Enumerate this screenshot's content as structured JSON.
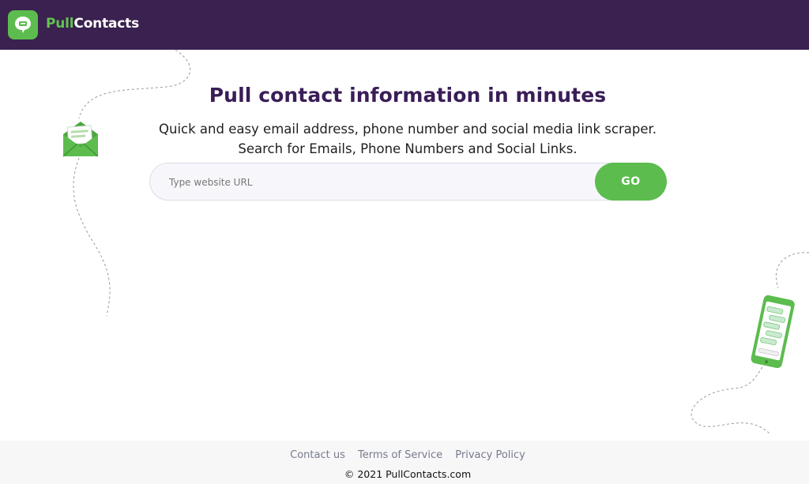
{
  "header": {
    "brand_part1": "Pull",
    "brand_part2": "Contacts",
    "logo_icon": "chat-bubble-icon",
    "background": "#3a2150",
    "brand_accent": "#62c24f"
  },
  "hero": {
    "title": "Pull contact information in minutes",
    "subtitle_line1": "Quick and easy email address, phone number and social media link scraper.",
    "subtitle_line2": "Search for Emails, Phone Numbers and Social Links."
  },
  "search": {
    "placeholder": "Type website URL",
    "value": "",
    "button_label": "GO",
    "button_color": "#5cbc4e"
  },
  "decorations": {
    "left_icon": "envelope-icon",
    "right_icon": "smartphone-icon"
  },
  "footer": {
    "links": [
      "Contact us",
      "Terms of Service",
      "Privacy Policy"
    ],
    "copyright": "© 2021 PullContacts.com"
  }
}
